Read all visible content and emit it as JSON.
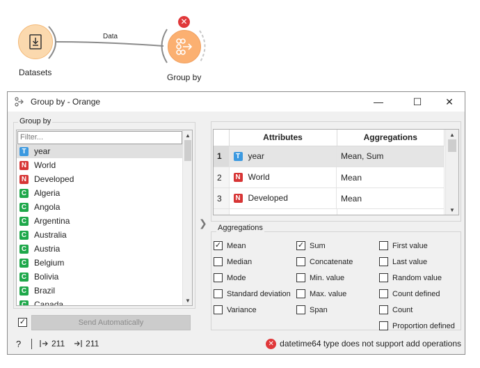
{
  "workflow": {
    "datasets_label": "Datasets",
    "link_label": "Data",
    "groupby_label": "Group by",
    "error_mark": "✕"
  },
  "window": {
    "title": "Group by - Orange",
    "minimize": "—",
    "maximize": "☐",
    "close": "✕"
  },
  "group_by": {
    "title": "Group by",
    "filter_placeholder": "Filter...",
    "items": [
      {
        "type": "T",
        "label": "year",
        "selected": true
      },
      {
        "type": "N",
        "label": "World"
      },
      {
        "type": "N",
        "label": "Developed"
      },
      {
        "type": "C",
        "label": "Algeria"
      },
      {
        "type": "C",
        "label": "Angola"
      },
      {
        "type": "C",
        "label": "Argentina"
      },
      {
        "type": "C",
        "label": "Australia"
      },
      {
        "type": "C",
        "label": "Austria"
      },
      {
        "type": "C",
        "label": "Belgium"
      },
      {
        "type": "C",
        "label": "Bolivia"
      },
      {
        "type": "C",
        "label": "Brazil"
      },
      {
        "type": "C",
        "label": "Canada"
      }
    ]
  },
  "attributes_table": {
    "headers": [
      "Attributes",
      "Aggregations"
    ],
    "rows": [
      {
        "index": "1",
        "type": "T",
        "attribute": "year",
        "aggregations": "Mean, Sum"
      },
      {
        "index": "2",
        "type": "N",
        "attribute": "World",
        "aggregations": "Mean"
      },
      {
        "index": "3",
        "type": "N",
        "attribute": "Developed",
        "aggregations": "Mean"
      }
    ]
  },
  "aggregations": {
    "title": "Aggregations",
    "col1": [
      {
        "label": "Mean",
        "checked": true
      },
      {
        "label": "Median",
        "checked": false
      },
      {
        "label": "Mode",
        "checked": false
      },
      {
        "label": "Standard deviation",
        "checked": false
      },
      {
        "label": "Variance",
        "checked": false
      }
    ],
    "col2": [
      {
        "label": "Sum",
        "checked": true
      },
      {
        "label": "Concatenate",
        "checked": false
      },
      {
        "label": "Min. value",
        "checked": false
      },
      {
        "label": "Max. value",
        "checked": false
      },
      {
        "label": "Span",
        "checked": false
      }
    ],
    "col3": [
      {
        "label": "First value",
        "checked": false
      },
      {
        "label": "Last value",
        "checked": false
      },
      {
        "label": "Random value",
        "checked": false
      },
      {
        "label": "Count defined",
        "checked": false
      },
      {
        "label": "Count",
        "checked": false
      },
      {
        "label": "Proportion defined",
        "checked": false
      }
    ]
  },
  "send": {
    "auto_checked": true,
    "label": "Send Automatically"
  },
  "status": {
    "help": "?",
    "input_count": "211",
    "output_count": "211",
    "error_message": "datetime64 type does not support add operations"
  },
  "colors": {
    "type_T": "#3b99e0",
    "type_N": "#d73535",
    "type_C": "#1ea84a",
    "error": "#e0383a",
    "node_fill": "#fbb071"
  }
}
